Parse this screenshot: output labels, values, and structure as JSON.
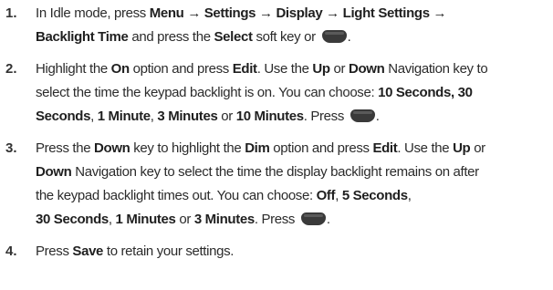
{
  "steps": [
    {
      "number": "1.",
      "line1": {
        "t1": "In Idle mode, press ",
        "b1": "Menu → Settings → Display → Light Settings →"
      },
      "line2": {
        "b1": "Backlight Time",
        "t1": " and press the ",
        "b2": "Select",
        "t2": " soft key or ",
        "t3": "."
      }
    },
    {
      "number": "2.",
      "line1": {
        "t1": "Highlight the ",
        "b1": "On",
        "t2": " option and press ",
        "b2": "Edit",
        "t3": ". Use the ",
        "b3": "Up",
        "t4": " or ",
        "b4": "Down",
        "t5": " Navigation key to"
      },
      "line2": {
        "t1": "select the time the keypad backlight is on. You can choose: ",
        "b1": "10 Seconds, 30"
      },
      "line3": {
        "b1": "Seconds",
        "t1": ", ",
        "b2": "1 Minute",
        "t2": ", ",
        "b3": "3 Minutes",
        "t3": " or ",
        "b4": "10 Minutes",
        "t4": ". Press ",
        "t5": "."
      }
    },
    {
      "number": "3.",
      "line1": {
        "t1": "Press the ",
        "b1": "Down",
        "t2": " key to highlight the ",
        "b2": "Dim",
        "t3": " option and press ",
        "b3": "Edit",
        "t4": ". Use the ",
        "b4": "Up",
        "t5": " or"
      },
      "line2": {
        "b1": "Down",
        "t1": " Navigation key to select the time the display backlight remains on after"
      },
      "line3": {
        "t1": "the keypad backlight times out. You can choose: ",
        "b1": "Off",
        "t2": ", ",
        "b2": "5 Seconds",
        "t3": ","
      },
      "line4": {
        "b1": "30 Seconds",
        "t1": ", ",
        "b2": "1 Minutes",
        "t2": " or ",
        "b3": "3 Minutes",
        "t3": ". Press ",
        "t4": "."
      }
    },
    {
      "number": "4.",
      "line1": {
        "t1": "Press ",
        "b1": "Save",
        "t2": " to retain your settings."
      }
    }
  ],
  "icons": {
    "select_key": "select-soft-key-icon"
  }
}
